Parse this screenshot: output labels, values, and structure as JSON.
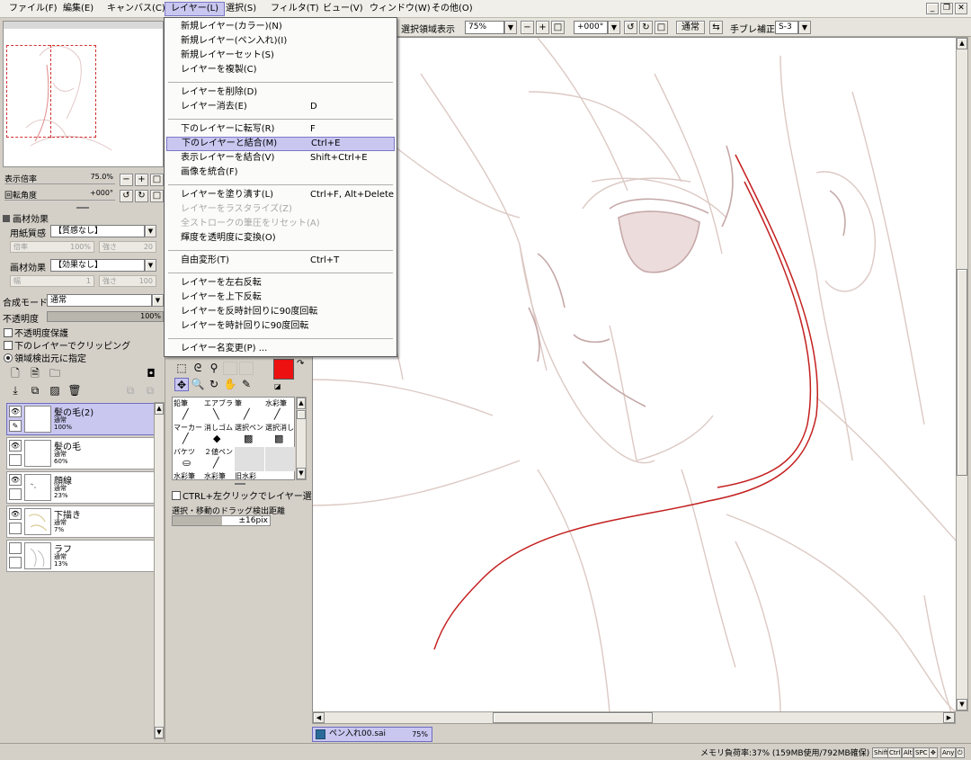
{
  "menubar": {
    "items": [
      "ファイル(F)",
      "編集(E)",
      "キャンバス(C)",
      "レイヤー(L)",
      "選択(S)",
      "フィルタ(T)",
      "ビュー(V)",
      "ウィンドウ(W)",
      "その他(O)"
    ],
    "active_item": "レイヤー(L)"
  },
  "toolbar": {
    "selection_display_label": "選択領域表示",
    "zoom_value": "75%",
    "rotation_value": "+000°",
    "blend_mode": "通常",
    "stabilizer_label": "手ブレ補正",
    "stabilizer_value": "S-3"
  },
  "navigator": {
    "zoom_label": "表示倍率",
    "zoom_value": "75.0%",
    "rotate_label": "回転角度",
    "rotate_value": "+000°"
  },
  "texture": {
    "section_title": "画材効果",
    "paper_label": "用紙質感",
    "paper_value": "【質感なし】",
    "paper_scale_label": "倍率",
    "paper_scale_value": "100%",
    "paper_strength_label": "強さ",
    "paper_strength_value": "20",
    "effect_label": "画材効果",
    "effect_value": "【効果なし】",
    "effect_width_label": "幅",
    "effect_width_value": "1",
    "effect_strength_label": "強さ",
    "effect_strength_value": "100"
  },
  "layer_props": {
    "blend_label": "合成モード",
    "blend_value": "通常",
    "opacity_label": "不透明度",
    "opacity_value": "100%",
    "opacity_level": 1.0,
    "preserve_opacity": "不透明度保護",
    "clip_lower": "下のレイヤーでクリッピング",
    "selection_source": "領域検出元に指定"
  },
  "layers": [
    {
      "name": "髪の毛(2)",
      "mode": "通常",
      "opacity": "100%",
      "selected": true
    },
    {
      "name": "髪の毛",
      "mode": "通常",
      "opacity": "60%",
      "selected": false
    },
    {
      "name": "顔線",
      "mode": "通常",
      "opacity": "23%",
      "selected": false
    },
    {
      "name": "下描き",
      "mode": "通常",
      "opacity": "7%",
      "selected": false
    },
    {
      "name": "ラフ",
      "mode": "通常",
      "opacity": "13%",
      "selected": false
    }
  ],
  "tools": {
    "brushes": [
      "鉛筆",
      "エアブラシ",
      "筆",
      "水彩筆",
      "マーカー",
      "消しゴム",
      "選択ペン",
      "選択消し",
      "バケツ",
      "２値ペン",
      "",
      "",
      "水彩筆",
      "水彩筆",
      "旧水彩",
      ""
    ],
    "ctrl_click_label": "CTRL+左クリックでレイヤー選択",
    "drag_distance_label": "選択・移動のドラッグ検出距離",
    "drag_distance_value": "±16pix",
    "primary_color": "#ee1111",
    "secondary_color": "#ffffff"
  },
  "layer_menu": {
    "items": [
      {
        "label": "新規レイヤー(カラー)(N)",
        "shortcut": "",
        "disabled": false
      },
      {
        "label": "新規レイヤー(ペン入れ)(I)",
        "shortcut": "",
        "disabled": false
      },
      {
        "label": "新規レイヤーセット(S)",
        "shortcut": "",
        "disabled": false
      },
      {
        "label": "レイヤーを複製(C)",
        "shortcut": "",
        "disabled": false
      },
      {
        "label": "レイヤーを削除(D)",
        "shortcut": "",
        "disabled": false
      },
      {
        "label": "レイヤー消去(E)",
        "shortcut": "D",
        "disabled": false
      },
      {
        "label": "下のレイヤーに転写(R)",
        "shortcut": "F",
        "disabled": false
      },
      {
        "label": "下のレイヤーと結合(M)",
        "shortcut": "Ctrl+E",
        "disabled": false,
        "highlighted": true
      },
      {
        "label": "表示レイヤーを結合(V)",
        "shortcut": "Shift+Ctrl+E",
        "disabled": false
      },
      {
        "label": "画像を統合(F)",
        "shortcut": "",
        "disabled": false
      },
      {
        "label": "レイヤーを塗り潰す(L)",
        "shortcut": "Ctrl+F, Alt+Delete",
        "disabled": false
      },
      {
        "label": "レイヤーをラスタライズ(Z)",
        "shortcut": "",
        "disabled": true
      },
      {
        "label": "全ストロークの筆圧をリセット(A)",
        "shortcut": "",
        "disabled": true
      },
      {
        "label": "輝度を透明度に変換(O)",
        "shortcut": "",
        "disabled": false
      },
      {
        "label": "自由変形(T)",
        "shortcut": "Ctrl+T",
        "disabled": false
      },
      {
        "label": "レイヤーを左右反転",
        "shortcut": "",
        "disabled": false
      },
      {
        "label": "レイヤーを上下反転",
        "shortcut": "",
        "disabled": false
      },
      {
        "label": "レイヤーを反時計回りに90度回転",
        "shortcut": "",
        "disabled": false
      },
      {
        "label": "レイヤーを時計回りに90度回転",
        "shortcut": "",
        "disabled": false
      },
      {
        "label": "レイヤー名変更(P) ...",
        "shortcut": "",
        "disabled": false
      }
    ]
  },
  "document_tab": {
    "name": "ペン入れ00.sai",
    "zoom": "75%"
  },
  "statusbar": {
    "memory": "メモリ負荷率:37% (159MB使用/792MB確保)",
    "keys": [
      "Shift",
      "Ctrl",
      "Alt",
      "SPC",
      "✥",
      "Any",
      "⏻"
    ]
  },
  "colors": {
    "highlight": "#c9c7f0",
    "highlight_border": "#6f6cc0",
    "stroke_red": "#c42020",
    "sketch": "#d8c8c2"
  }
}
